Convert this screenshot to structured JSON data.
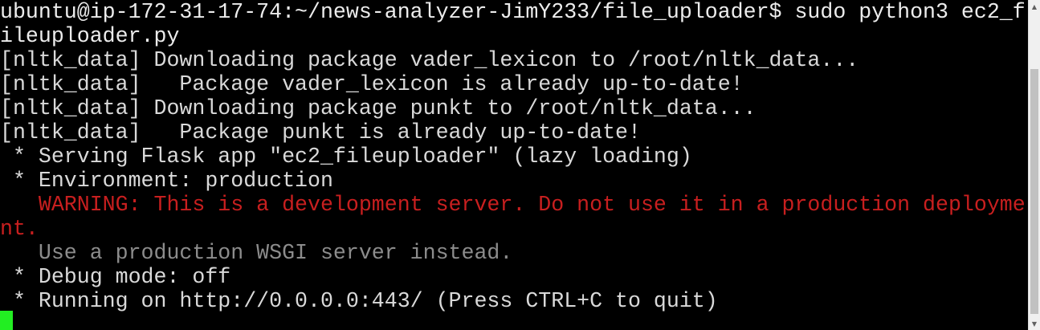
{
  "terminal": {
    "lines": [
      "ubuntu@ip-172-31-17-74:~/news-analyzer-JimY233/file_uploader$ sudo python3 ec2_f",
      "ileuploader.py",
      "[nltk_data] Downloading package vader_lexicon to /root/nltk_data...",
      "[nltk_data]   Package vader_lexicon is already up-to-date!",
      "[nltk_data] Downloading package punkt to /root/nltk_data...",
      "[nltk_data]   Package punkt is already up-to-date!",
      " * Serving Flask app \"ec2_fileuploader\" (lazy loading)",
      " * Environment: production",
      "   WARNING: This is a development server. Do not use it in a production deployme",
      "nt.",
      "   Use a production WSGI server instead.",
      " * Debug mode: off",
      " * Running on http://0.0.0.0:443/ (Press CTRL+C to quit)"
    ],
    "colors": {
      "background": "#000000",
      "text": "#d9d9d9",
      "warning": "#c81f1f",
      "hint": "#8c8c8c",
      "cursor": "#22ee22"
    }
  },
  "scrollbar": {
    "up_icon": "scroll-up-arrow-icon",
    "down_icon": "scroll-down-arrow-icon",
    "up_glyph": "▲",
    "down_glyph": "▼"
  }
}
